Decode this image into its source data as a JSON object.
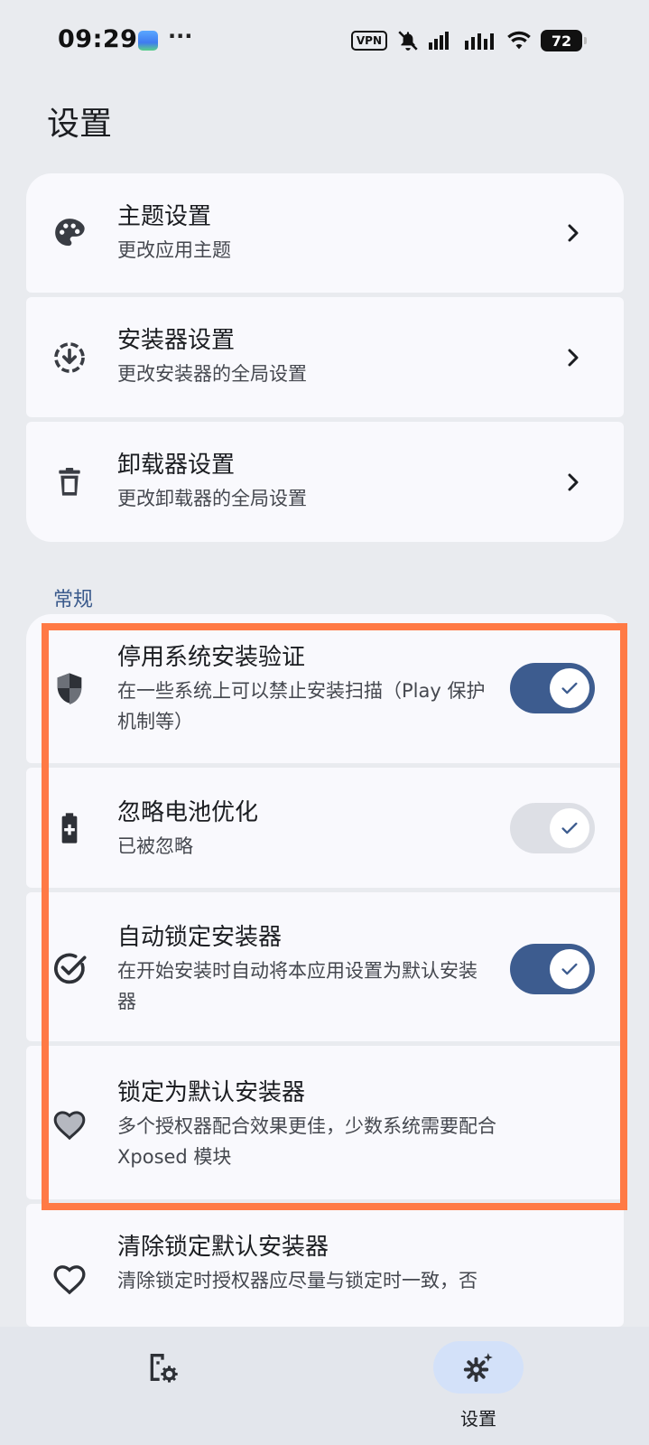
{
  "status_bar": {
    "time": "09:29",
    "more": "···",
    "vpn": "VPN",
    "battery": "72"
  },
  "page": {
    "title": "设置"
  },
  "cards": [
    {
      "title": "主题设置",
      "subtitle": "更改应用主题",
      "icon": "palette-icon"
    },
    {
      "title": "安装器设置",
      "subtitle": "更改安装器的全局设置",
      "icon": "download-circle-icon"
    },
    {
      "title": "卸载器设置",
      "subtitle": "更改卸载器的全局设置",
      "icon": "trash-icon"
    }
  ],
  "general": {
    "label": "常规",
    "items": [
      {
        "title": "停用系统安装验证",
        "subtitle": "在一些系统上可以禁止安装扫描（Play 保护机制等）",
        "icon": "shield-icon",
        "toggle": true
      },
      {
        "title": "忽略电池优化",
        "subtitle": "已被忽略",
        "icon": "battery-icon",
        "toggle": false
      },
      {
        "title": "自动锁定安装器",
        "subtitle": "在开始安装时自动将本应用设置为默认安装器",
        "icon": "check-circle-icon",
        "toggle": true
      },
      {
        "title": "锁定为默认安装器",
        "subtitle": "多个授权器配合效果更佳，少数系统需要配合 Xposed 模块",
        "icon": "heart-filled-icon"
      },
      {
        "title": "清除锁定默认安装器",
        "subtitle": "清除锁定时授权器应尽量与锁定时一致，否",
        "icon": "heart-outline-icon"
      }
    ]
  },
  "bottom_nav": {
    "items": [
      {
        "label": "",
        "icon": "app-settings-icon"
      },
      {
        "label": "设置",
        "icon": "gear-sparkle-icon",
        "active": true
      }
    ]
  },
  "colors": {
    "accent": "#3d5c8f",
    "highlight": "#ff7a45",
    "card_bg": "#f9f9fd",
    "page_bg": "#e9ebef"
  }
}
